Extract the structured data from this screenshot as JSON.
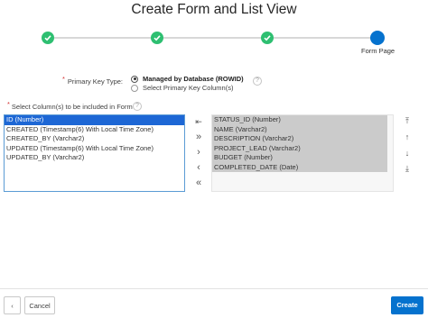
{
  "dialog": {
    "title": "Create Form and List View"
  },
  "wizard": {
    "steps": [
      {
        "state": "done",
        "label": ""
      },
      {
        "state": "done",
        "label": ""
      },
      {
        "state": "done",
        "label": ""
      },
      {
        "state": "current",
        "label": "Form Page"
      }
    ]
  },
  "primary_key": {
    "label": "Primary Key Type:",
    "required_marker": "*",
    "options": [
      {
        "label": "Managed by Database (ROWID)",
        "checked": true
      },
      {
        "label": "Select Primary Key Column(s)",
        "checked": false
      }
    ],
    "help_icon": "?"
  },
  "columns": {
    "required_marker": "*",
    "label": "Select Column(s) to be included in Form",
    "help_icon": "?",
    "available": [
      "ID (Number)",
      "CREATED (Timestamp(6) With Local Time Zone)",
      "CREATED_BY (Varchar2)",
      "UPDATED (Timestamp(6) With Local Time Zone)",
      "UPDATED_BY (Varchar2)"
    ],
    "available_selected_index": 0,
    "selected": [
      "STATUS_ID (Number)",
      "NAME (Varchar2)",
      "DESCRIPTION (Varchar2)",
      "PROJECT_LEAD (Varchar2)",
      "BUDGET (Number)",
      "COMPLETED_DATE (Date)"
    ]
  },
  "shuttle_controls": {
    "reset": "⇤",
    "move_all": "»",
    "move": "›",
    "remove": "‹",
    "remove_all": "«"
  },
  "order_controls": {
    "top": "⤒",
    "up": "↑",
    "down": "↓",
    "bottom": "⤓"
  },
  "footer": {
    "back": "‹",
    "cancel": "Cancel",
    "create": "Create"
  },
  "colors": {
    "accent": "#0572ce",
    "done": "#2ebf71",
    "selected": "#1d67d5"
  }
}
